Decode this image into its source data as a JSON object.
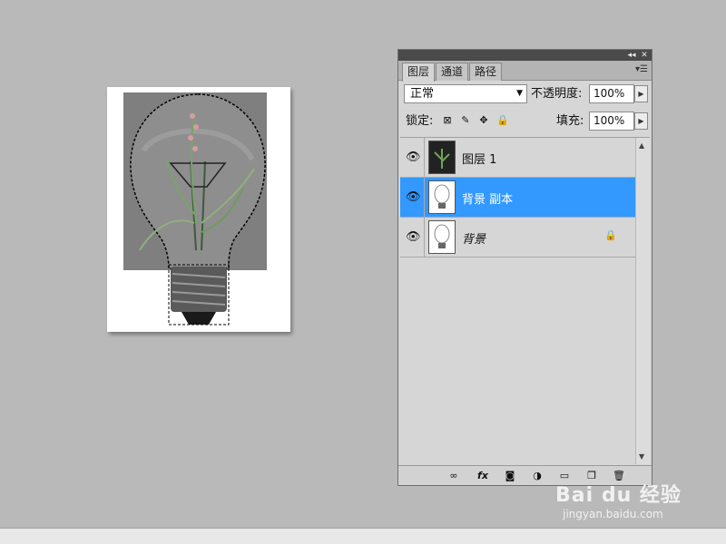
{
  "panel": {
    "title_controls": {
      "collapse": "◂◂",
      "close": "✕"
    },
    "tabs": [
      {
        "label": "图层",
        "active": true
      },
      {
        "label": "通道",
        "active": false
      },
      {
        "label": "路径",
        "active": false
      }
    ],
    "menu_icon": "panel-menu-icon",
    "blend_mode": "正常",
    "opacity_label": "不透明度:",
    "opacity_value": "100%",
    "lock_label": "锁定:",
    "fill_label": "填充:",
    "fill_value": "100%",
    "lock_icons": [
      "lock-transparent-icon",
      "lock-paint-icon",
      "lock-move-icon",
      "lock-all-icon"
    ],
    "layers": [
      {
        "name": "图层 1",
        "selected": false,
        "visible": true,
        "locked": false,
        "italic": false
      },
      {
        "name": "背景 副本",
        "selected": true,
        "visible": true,
        "locked": false,
        "italic": false
      },
      {
        "name": "背景",
        "selected": false,
        "visible": true,
        "locked": true,
        "italic": true
      }
    ],
    "bottom_buttons": [
      "link-layers-icon",
      "fx-icon",
      "layer-mask-icon",
      "adjustment-layer-icon",
      "new-group-icon",
      "new-layer-icon",
      "delete-layer-icon"
    ],
    "fx_label": "fx"
  },
  "watermark": {
    "brand": "Bai du 经验",
    "url": "jingyan.baidu.com"
  },
  "colors": {
    "background": "#b9b9b9",
    "selection": "#3399ff",
    "panel": "#d6d6d6"
  }
}
